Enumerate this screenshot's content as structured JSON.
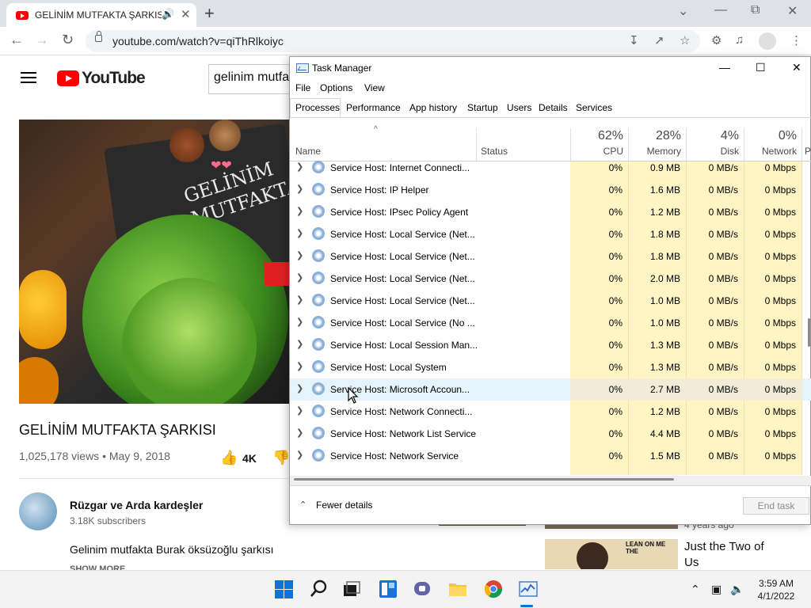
{
  "browser": {
    "tab_title": "GELİNİM MUTFAKTA ŞARKISI",
    "url": "youtube.com/watch?v=qiThRlkoiyc",
    "window_controls": [
      "chevron-down",
      "minimize",
      "restore",
      "close"
    ]
  },
  "youtube": {
    "logo_text": "YouTube",
    "search_value": "gelinim mutfa",
    "video_title": "GELİNİM MUTFAKTA ŞARKISI",
    "views_date": "1,025,178 views • May 9, 2018",
    "likes": "4K",
    "video_board_text": [
      "GELİNİM",
      "MUTFAKTA"
    ],
    "channel_name": "Rüzgar ve Arda kardeşler",
    "subscribers": "3.18K subscribers",
    "description": "Gelinim mutfakta Burak öksüzoğlu şarkısı",
    "show_more": "SHOW MORE",
    "rec_meta": "4 years ago",
    "rec_title": "Just the Two of Us",
    "rec_thumb_text": "LEAN ON ME THE"
  },
  "task_manager": {
    "title": "Task Manager",
    "menu": [
      "File",
      "Options",
      "View"
    ],
    "tabs": [
      "Processes",
      "Performance",
      "App history",
      "Startup",
      "Users",
      "Details",
      "Services"
    ],
    "active_tab": "Processes",
    "columns": {
      "name": "Name",
      "status": "Status",
      "cpu_pct": "62%",
      "cpu": "CPU",
      "memory_pct": "28%",
      "memory": "Memory",
      "disk_pct": "4%",
      "disk": "Disk",
      "network_pct": "0%",
      "network": "Network",
      "next": "P"
    },
    "rows": [
      {
        "name": "Service Host: Internet Connecti...",
        "cpu": "0%",
        "memory": "0.9 MB",
        "disk": "0 MB/s",
        "network": "0 Mbps"
      },
      {
        "name": "Service Host: IP Helper",
        "cpu": "0%",
        "memory": "1.6 MB",
        "disk": "0 MB/s",
        "network": "0 Mbps"
      },
      {
        "name": "Service Host: IPsec Policy Agent",
        "cpu": "0%",
        "memory": "1.2 MB",
        "disk": "0 MB/s",
        "network": "0 Mbps"
      },
      {
        "name": "Service Host: Local Service (Net...",
        "cpu": "0%",
        "memory": "1.8 MB",
        "disk": "0 MB/s",
        "network": "0 Mbps"
      },
      {
        "name": "Service Host: Local Service (Net...",
        "cpu": "0%",
        "memory": "1.8 MB",
        "disk": "0 MB/s",
        "network": "0 Mbps"
      },
      {
        "name": "Service Host: Local Service (Net...",
        "cpu": "0%",
        "memory": "2.0 MB",
        "disk": "0 MB/s",
        "network": "0 Mbps"
      },
      {
        "name": "Service Host: Local Service (Net...",
        "cpu": "0%",
        "memory": "1.0 MB",
        "disk": "0 MB/s",
        "network": "0 Mbps"
      },
      {
        "name": "Service Host: Local Service (No ...",
        "cpu": "0%",
        "memory": "1.0 MB",
        "disk": "0 MB/s",
        "network": "0 Mbps"
      },
      {
        "name": "Service Host: Local Session Man...",
        "cpu": "0%",
        "memory": "1.3 MB",
        "disk": "0 MB/s",
        "network": "0 Mbps"
      },
      {
        "name": "Service Host: Local System",
        "cpu": "0%",
        "memory": "1.3 MB",
        "disk": "0 MB/s",
        "network": "0 Mbps"
      },
      {
        "name": "Service Host: Microsoft Accoun...",
        "cpu": "0%",
        "memory": "2.7 MB",
        "disk": "0 MB/s",
        "network": "0 Mbps"
      },
      {
        "name": "Service Host: Network Connecti...",
        "cpu": "0%",
        "memory": "1.2 MB",
        "disk": "0 MB/s",
        "network": "0 Mbps"
      },
      {
        "name": "Service Host: Network List Service",
        "cpu": "0%",
        "memory": "4.4 MB",
        "disk": "0 MB/s",
        "network": "0 Mbps"
      },
      {
        "name": "Service Host: Network Service",
        "cpu": "0%",
        "memory": "1.5 MB",
        "disk": "0 MB/s",
        "network": "0 Mbps"
      }
    ],
    "highlighted_row": "Service Host: Microsoft Accoun...",
    "fewer_details": "Fewer details",
    "end_task": "End task"
  },
  "taskbar": {
    "apps": [
      "start",
      "search",
      "task-view",
      "widgets",
      "chat",
      "file-explorer",
      "chrome",
      "task-manager"
    ],
    "time": "3:59 AM",
    "date": "4/1/2022"
  },
  "colors": {
    "youtube_red": "#ff0000",
    "usage_highlight": "#fff4c4",
    "row_hover": "#e5f3fb",
    "windows_accent": "#0a74da"
  }
}
